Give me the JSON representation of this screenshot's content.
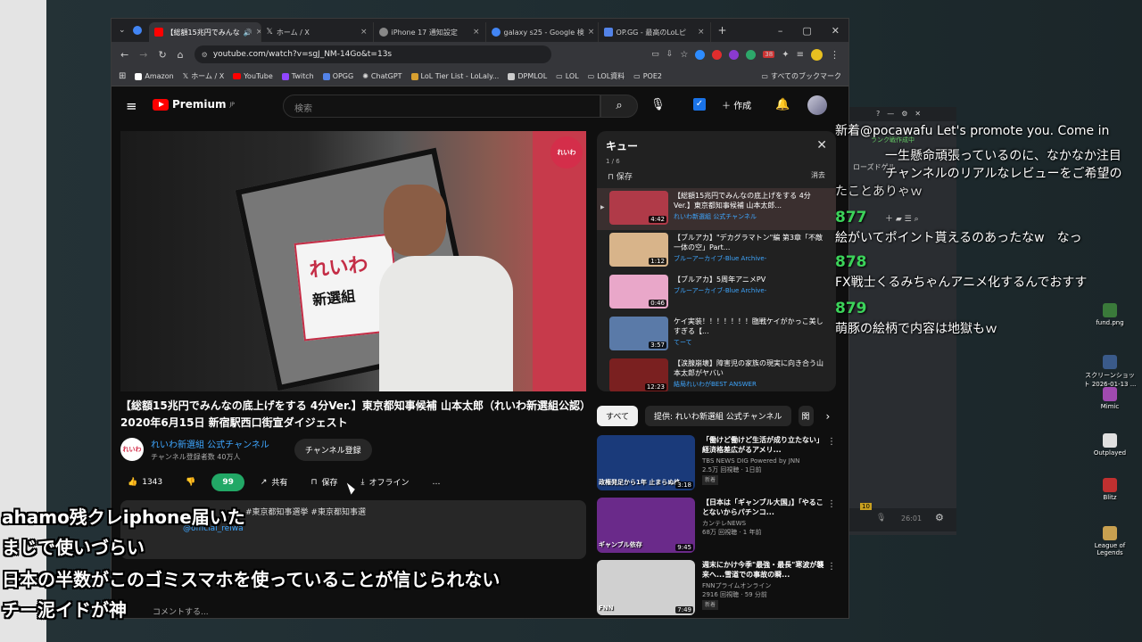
{
  "browser": {
    "tabs": [
      {
        "label": "【総額15兆円でみんな",
        "active": true,
        "favicon_color": "#ff0000"
      },
      {
        "label": "ホーム / X",
        "active": false,
        "favicon_color": "#ffffff"
      },
      {
        "label": "iPhone 17 通知設定",
        "active": false,
        "favicon_color": "#888888"
      },
      {
        "label": "galaxy s25 - Google 検",
        "active": false,
        "favicon_color": "#4285f4"
      },
      {
        "label": "OP.GG - 最高のLoLピ",
        "active": false,
        "favicon_color": "#5383e8"
      }
    ],
    "url": "youtube.com/watch?v=sgJ_NM-14Go&t=13s",
    "ext_badge": "38",
    "bookmarks": [
      "Amazon",
      "ホーム / X",
      "YouTube",
      "Twitch",
      "OPGG",
      "ChatGPT",
      "LoL Tier List - LoLaly...",
      "DPMLOL",
      "LOL",
      "LOL資料",
      "POE2"
    ],
    "all_bookmarks": "すべてのブックマーク"
  },
  "youtube": {
    "logo": "Premium",
    "logo_region": "JP",
    "search_placeholder": "検索",
    "create_label": "作成",
    "video_title": "【総額15兆円でみんなの底上げをする 4分Ver.】東京都知事候補 山本太郎（れいわ新選組公認）2020年6月15日 新宿駅西口街宣ダイジェスト",
    "video_badge": "れいわ",
    "sign_line1": "れいわ",
    "sign_line2": "新選組",
    "channel_avatar": "れいわ",
    "channel_name": "れいわ新選組 公式チャンネル",
    "channel_subs": "チャンネル登録者数 40万人",
    "subscribe_label": "チャンネル登録",
    "likes": "1343",
    "thanks_label": "99",
    "share_label": "共有",
    "save_label": "保存",
    "offline_label": "オフライン",
    "more_label": "…",
    "desc_line1": "#東京都知事選挙 #東京都知事選",
    "desc_tag": "@official_reiwa",
    "comment_placeholder": "コメントする..."
  },
  "queue": {
    "title": "キュー",
    "count": "1 / 6",
    "save": "保存",
    "clear": "消去",
    "items": [
      {
        "title": "【総額15兆円でみんなの底上げをする 4分Ver.】東京都知事候補 山本太郎...",
        "channel": "れいわ新選組 公式チャンネル",
        "duration": "4:42",
        "thumb": "#b03a48"
      },
      {
        "title": "【ブルアカ】\"デカグラマトン\"編 第3章「不敵一体の空」Part...",
        "channel": "ブルーアーカイブ-Blue Archive-",
        "duration": "1:12",
        "thumb": "#d8b48a"
      },
      {
        "title": "【ブルアカ】5周年アニメPV",
        "channel": "ブルーアーカイブ-Blue Archive-",
        "duration": "0:46",
        "thumb": "#e9a7c9"
      },
      {
        "title": "ケイ実装！！！！！！！臨戦ケイがかっこ美しすぎる【...",
        "channel": "てーて",
        "duration": "3:57",
        "thumb": "#5a7aa8"
      },
      {
        "title": "【涙腺崩壊】障害児の家族の現実に向き合う山本太郎がヤバい",
        "channel": "結局れいわがBEST ANSWER",
        "duration": "12:23",
        "thumb": "#7a2020"
      }
    ]
  },
  "chips": [
    "すべて",
    "提供: れいわ新選組 公式チャンネル",
    "関"
  ],
  "recommendations": [
    {
      "title": "「働けど働けど生活が成り立たない」経済格差広がるアメリ...",
      "channel": "TBS NEWS DIG Powered by JNN",
      "meta": "2.5万 回視聴 · 1日前",
      "new": "新着",
      "duration": "3:18",
      "thumb": "#1a3a7a",
      "overlay": "政権発足から1年 止まらぬ格"
    },
    {
      "title": "【日本は「ギャンブル大国」】「やることないからパチンコ...",
      "channel": "カンテレNEWS",
      "meta": "68万 回視聴 · 1 年前",
      "new": "",
      "duration": "9:45",
      "thumb": "#6a2a8a",
      "overlay": "ギャンブル依存"
    },
    {
      "title": "週末にかけ今季\"最強・最長\"寒波が襲来へ...雪道での事故の瞬...",
      "channel": "FNNプライムオンライン",
      "meta": "2916 回視聴 · 59 分前",
      "new": "新着",
      "duration": "7:49",
      "thumb": "#d0d0d0",
      "overlay": "FNN"
    }
  ],
  "livechat": {
    "lines": [
      {
        "kind": "text",
        "text": "新着@pocawafu Let's promote you. Come in"
      },
      {
        "kind": "text",
        "text": "一生懸命頑張っているのに、なかなか注目"
      },
      {
        "kind": "text",
        "text": "チャンネルのリアルなレビューをご希望の"
      },
      {
        "kind": "text",
        "text": "たことありゃｗ"
      },
      {
        "kind": "num",
        "text": "877"
      },
      {
        "kind": "text",
        "text": "絵がいてポイント貰えるのあったなw　なっ"
      },
      {
        "kind": "num",
        "text": "878"
      },
      {
        "kind": "text",
        "text": "FX戦士くるみちゃんアニメ化するんでおすす"
      },
      {
        "kind": "num",
        "text": "879"
      },
      {
        "kind": "text",
        "text": "萌豚の絵柄で内容は地獄もｗ"
      }
    ],
    "rank_text": "ランク戦作成中",
    "rose_text": "ローズドゲル",
    "clock": "26:01",
    "level": "10"
  },
  "desktop_icons": [
    {
      "label": "fund.png",
      "color": "#3a7a3a"
    },
    {
      "label": "スクリーンショット 2026-01-13 ...",
      "color": "#3a5a8a"
    },
    {
      "label": "Mimic",
      "color": "#a04ab0"
    },
    {
      "label": "Outplayed",
      "color": "#e0e0e0"
    },
    {
      "label": "Blitz",
      "color": "#c03030"
    },
    {
      "label": "League of Legends",
      "color": "#c8a050"
    }
  ],
  "subtitles": [
    "ahamo残クレiphone届いた",
    "まじで使いづらい",
    "日本の半数がこのゴミスマホを使っていることが信じられない",
    "チー泥イドが神"
  ]
}
